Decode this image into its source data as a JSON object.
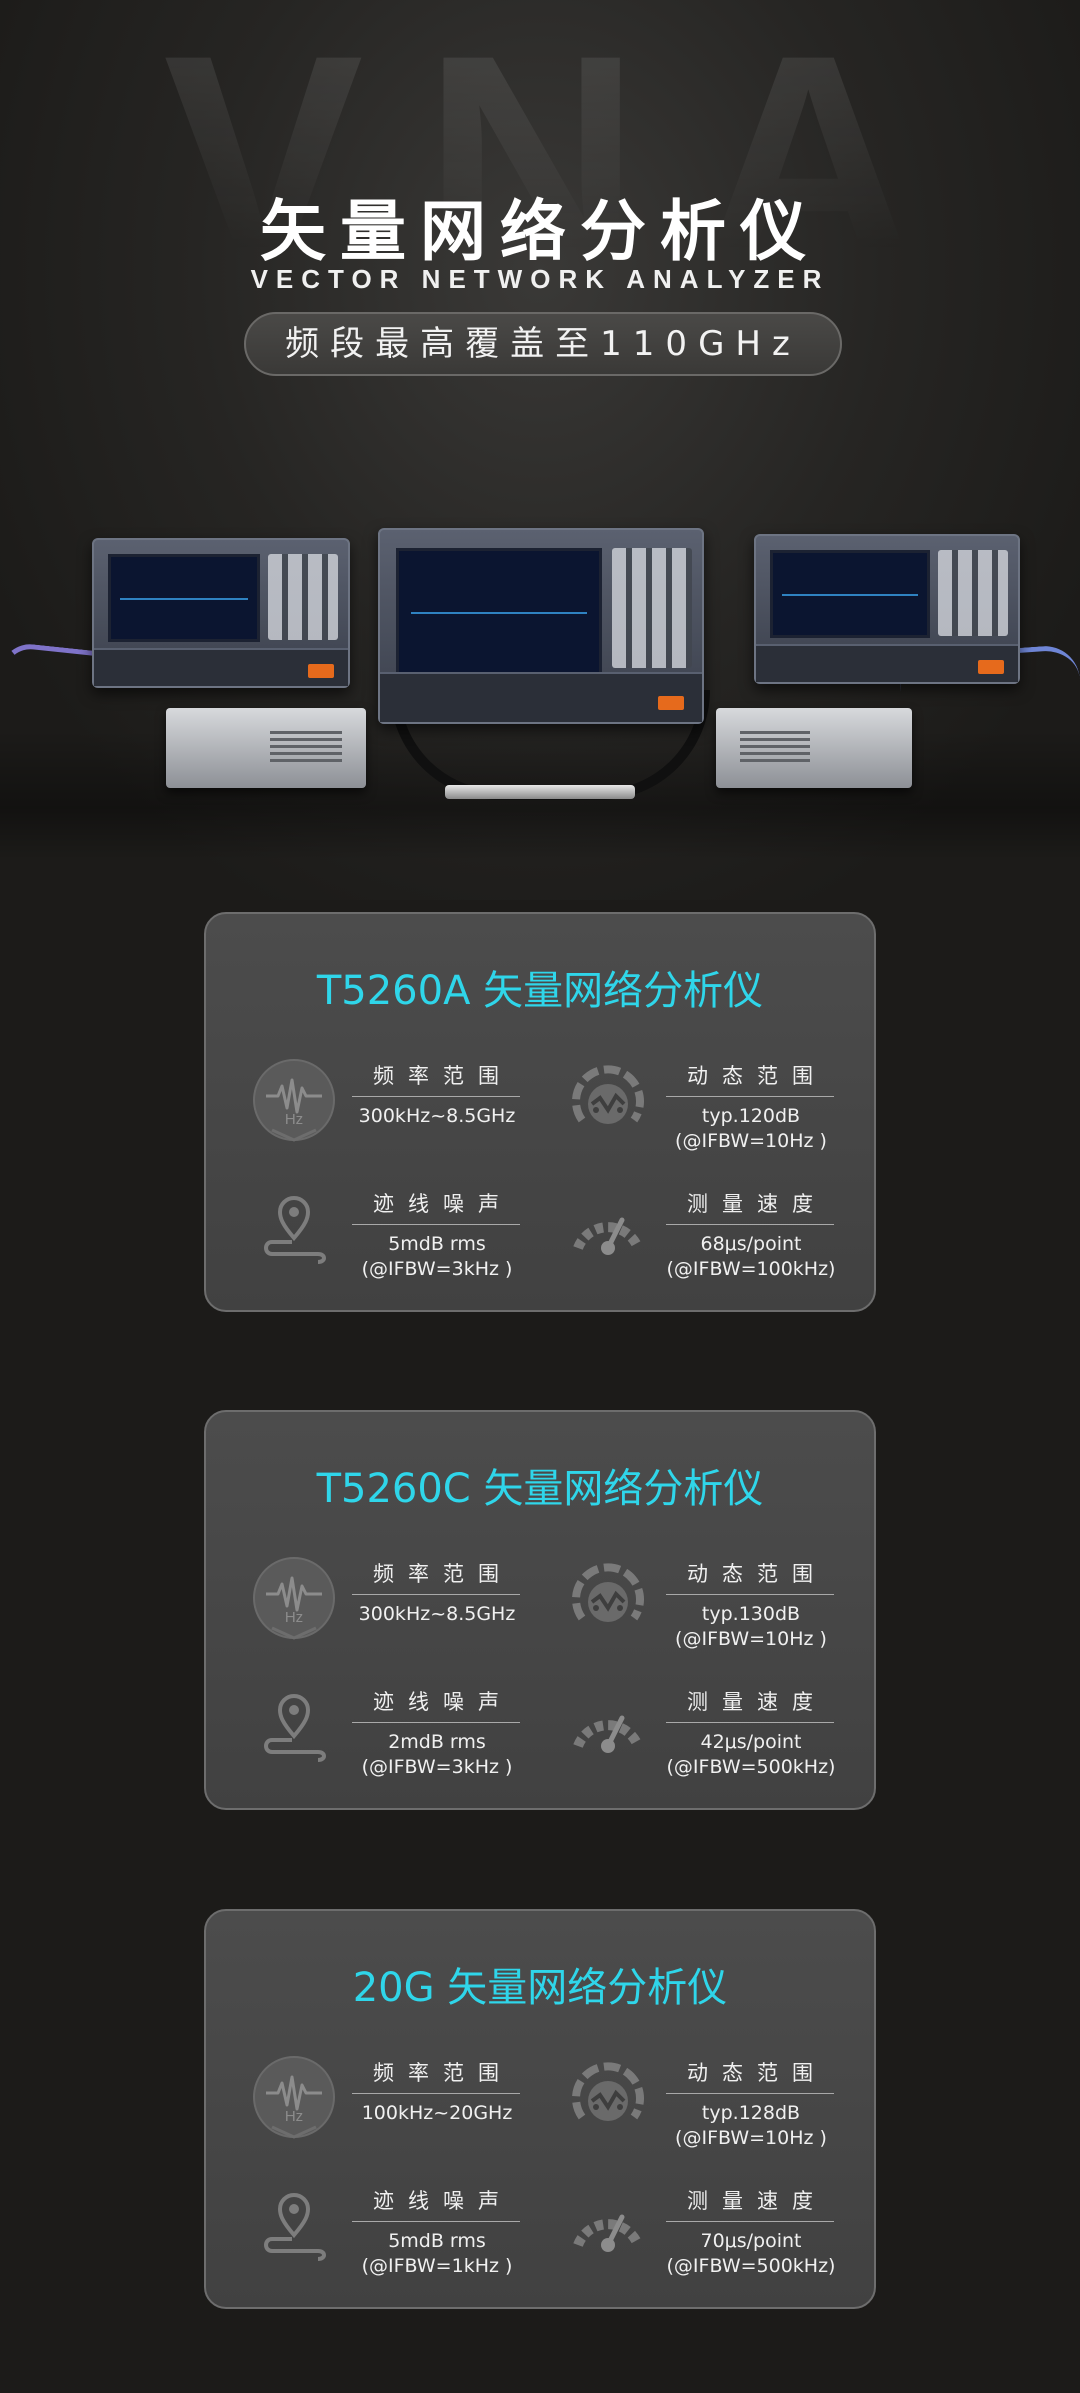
{
  "hero": {
    "watermark": "VNA",
    "title": "矢量网络分析仪",
    "subtitle": "VECTOR NETWORK ANALYZER",
    "pill": "频段最高覆盖至110GHz"
  },
  "colors": {
    "accent": "#2fd6ea",
    "background": "#1c1b19",
    "card": "#454545"
  },
  "cards": [
    {
      "title": "T5260A 矢量网络分析仪",
      "specs": {
        "freq": {
          "label": "频率范围",
          "icon": "frequency-hz-icon",
          "lines": [
            "300kHz~8.5GHz"
          ]
        },
        "dyn": {
          "label": "动态范围",
          "icon": "dynamic-range-icon",
          "lines": [
            "typ.120dB",
            "(@IFBW=10Hz )"
          ]
        },
        "noise": {
          "label": "迹线噪声",
          "icon": "trace-path-icon",
          "lines": [
            "5mdB rms",
            "(@IFBW=3kHz )"
          ]
        },
        "speed": {
          "label": "测量速度",
          "icon": "speedometer-icon",
          "lines": [
            "68μs/point",
            "(@IFBW=100kHz)"
          ]
        }
      }
    },
    {
      "title": "T5260C 矢量网络分析仪",
      "specs": {
        "freq": {
          "label": "频率范围",
          "icon": "frequency-hz-icon",
          "lines": [
            "300kHz~8.5GHz"
          ]
        },
        "dyn": {
          "label": "动态范围",
          "icon": "dynamic-range-icon",
          "lines": [
            "typ.130dB",
            "(@IFBW=10Hz )"
          ]
        },
        "noise": {
          "label": "迹线噪声",
          "icon": "trace-path-icon",
          "lines": [
            "2mdB rms",
            "(@IFBW=3kHz )"
          ]
        },
        "speed": {
          "label": "测量速度",
          "icon": "speedometer-icon",
          "lines": [
            "42μs/point",
            "(@IFBW=500kHz)"
          ]
        }
      }
    },
    {
      "title": "20G 矢量网络分析仪",
      "specs": {
        "freq": {
          "label": "频率范围",
          "icon": "frequency-hz-icon",
          "lines": [
            "100kHz~20GHz"
          ]
        },
        "dyn": {
          "label": "动态范围",
          "icon": "dynamic-range-icon",
          "lines": [
            "typ.128dB",
            "(@IFBW=10Hz )"
          ]
        },
        "noise": {
          "label": "迹线噪声",
          "icon": "trace-path-icon",
          "lines": [
            "5mdB rms",
            "(@IFBW=1kHz )"
          ]
        },
        "speed": {
          "label": "测量速度",
          "icon": "speedometer-icon",
          "lines": [
            "70μs/point",
            "(@IFBW=500kHz)"
          ]
        }
      }
    }
  ]
}
